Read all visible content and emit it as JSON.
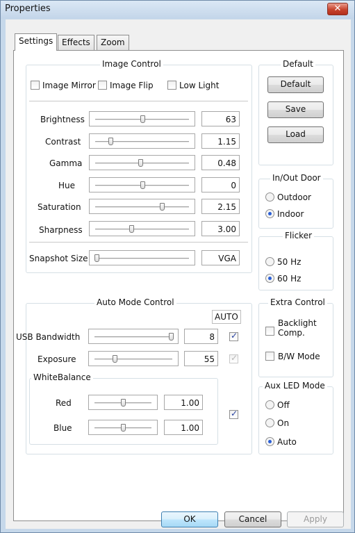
{
  "window": {
    "title": "Properties"
  },
  "tabs": [
    {
      "label": "Settings",
      "active": true
    },
    {
      "label": "Effects",
      "active": false
    },
    {
      "label": "Zoom",
      "active": false
    }
  ],
  "image_control": {
    "title": "Image Control",
    "checkboxes": [
      {
        "label": "Image Mirror",
        "checked": false
      },
      {
        "label": "Image Flip",
        "checked": false
      },
      {
        "label": "Low Light",
        "checked": false
      }
    ],
    "sliders": [
      {
        "label": "Brightness",
        "value": "63",
        "fraction": 0.5
      },
      {
        "label": "Contrast",
        "value": "1.15",
        "fraction": 0.15
      },
      {
        "label": "Gamma",
        "value": "0.48",
        "fraction": 0.48
      },
      {
        "label": "Hue",
        "value": "0",
        "fraction": 0.5
      },
      {
        "label": "Saturation",
        "value": "2.15",
        "fraction": 0.72
      },
      {
        "label": "Sharpness",
        "value": "3.00",
        "fraction": 0.38
      }
    ],
    "snapshot": {
      "label": "Snapshot Size",
      "value": "VGA",
      "fraction": 0.0
    }
  },
  "default_group": {
    "title": "Default",
    "buttons": {
      "default": "Default",
      "save": "Save",
      "load": "Load"
    }
  },
  "inout_door": {
    "title": "In/Out Door",
    "options": [
      {
        "label": "Outdoor",
        "selected": false
      },
      {
        "label": "Indoor",
        "selected": true
      }
    ]
  },
  "flicker": {
    "title": "Flicker",
    "options": [
      {
        "label": "50 Hz",
        "selected": false
      },
      {
        "label": "60 Hz",
        "selected": true
      }
    ]
  },
  "auto_mode": {
    "title": "Auto Mode Control",
    "auto_label": "AUTO",
    "usb_bandwidth": {
      "label": "USB Bandwidth",
      "value": "8",
      "fraction": 1.0,
      "auto": true
    },
    "exposure": {
      "label": "Exposure",
      "value": "55",
      "fraction": 0.25,
      "auto": true,
      "auto_disabled": true
    },
    "white_balance": {
      "title": "WhiteBalance",
      "auto": true,
      "red": {
        "label": "Red",
        "value": "1.00",
        "fraction": 0.5
      },
      "blue": {
        "label": "Blue",
        "value": "1.00",
        "fraction": 0.5
      }
    }
  },
  "extra_control": {
    "title": "Extra Control",
    "backlight_line1": "Backlight",
    "backlight_line2": "Comp.",
    "bw_mode": "B/W Mode"
  },
  "aux_led": {
    "title": "Aux LED Mode",
    "options": [
      {
        "label": "Off",
        "selected": false
      },
      {
        "label": "On",
        "selected": false
      },
      {
        "label": "Auto",
        "selected": true
      }
    ]
  },
  "footer": {
    "ok": "OK",
    "cancel": "Cancel",
    "apply": "Apply"
  },
  "icons": {
    "close": "close-icon"
  }
}
